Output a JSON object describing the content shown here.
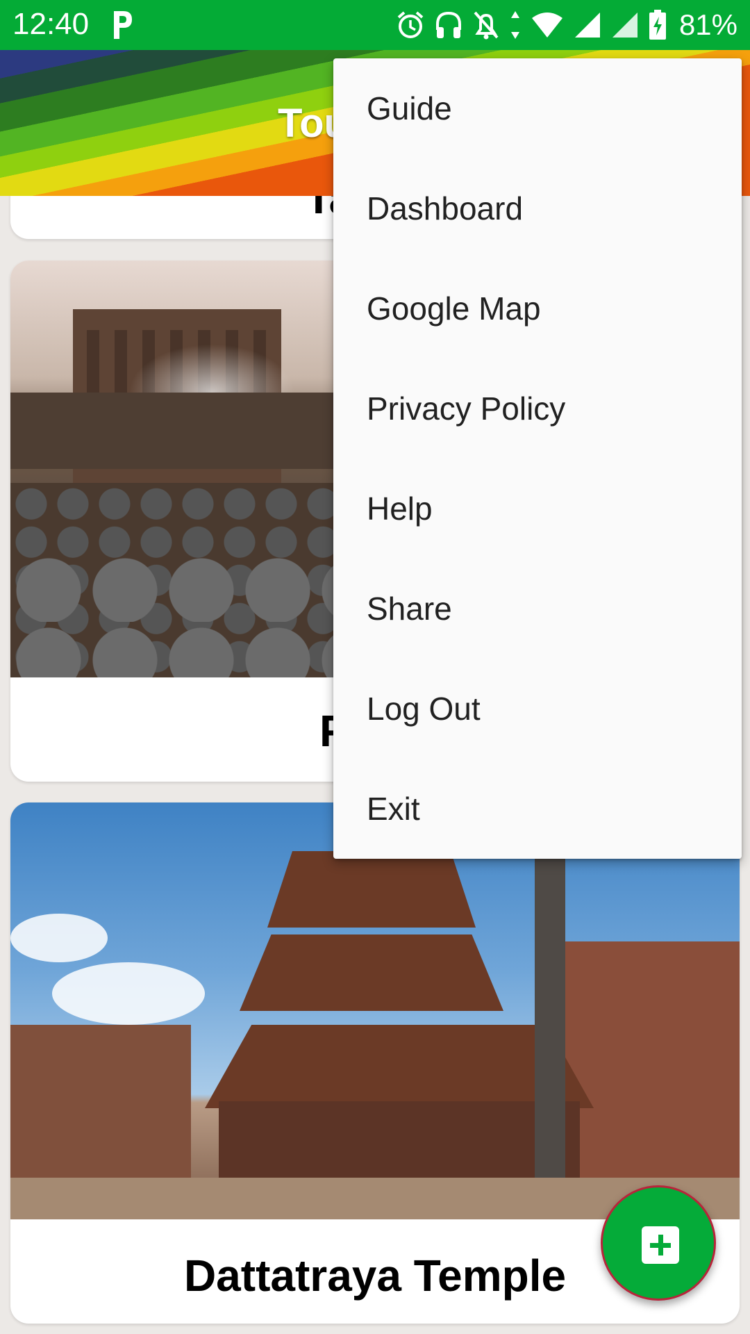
{
  "status_bar": {
    "time": "12:40",
    "battery": "81%",
    "icons": [
      "parking-icon",
      "alarm-icon",
      "headset-icon",
      "notifications-off-icon",
      "data-arrows-icon",
      "wifi-icon",
      "signal-icon",
      "signal-icon",
      "battery-charging-icon"
    ]
  },
  "toolbar": {
    "title": "Tou"
  },
  "cards": [
    {
      "title": "Tauma"
    },
    {
      "title": "Potte"
    },
    {
      "title": "Dattatraya Temple"
    }
  ],
  "menu": {
    "items": [
      {
        "label": "Guide"
      },
      {
        "label": "Dashboard"
      },
      {
        "label": "Google Map"
      },
      {
        "label": "Privacy Policy"
      },
      {
        "label": "Help"
      },
      {
        "label": "Share"
      },
      {
        "label": "Log Out"
      },
      {
        "label": "Exit"
      }
    ]
  },
  "fab": {
    "icon": "add-icon"
  },
  "colors": {
    "status_bar": "#04ab36",
    "fab": "#05ab39",
    "fab_border": "#b8243a",
    "menu_background": "#fafafa",
    "page_background": "#ece9e6"
  }
}
